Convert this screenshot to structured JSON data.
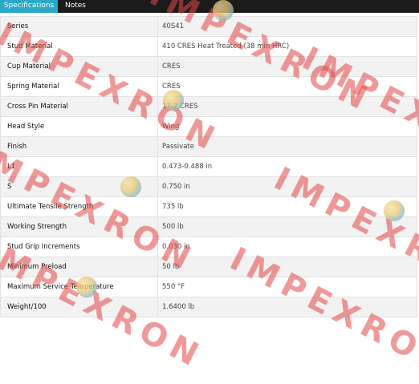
{
  "tabs": [
    {
      "label": "Specifications",
      "active": true
    },
    {
      "label": "Notes",
      "active": false
    }
  ],
  "specs": [
    {
      "label": "Series",
      "value": "40S41"
    },
    {
      "label": "Stud Material",
      "value": "410 CRES Heat Treated (38 min HRC)"
    },
    {
      "label": "Cup Material",
      "value": "CRES"
    },
    {
      "label": "Spring Material",
      "value": "CRES"
    },
    {
      "label": "Cross Pin Material",
      "value": "17-7 CRES"
    },
    {
      "label": "Head Style",
      "value": "Wing"
    },
    {
      "label": "Finish",
      "value": "Passivate"
    },
    {
      "label": "L1",
      "value": "0.473-0.488 in"
    },
    {
      "label": "S",
      "value": "0.750 in"
    },
    {
      "label": "Ultimate Tensile Strength",
      "value": "735 lb"
    },
    {
      "label": "Working Strength",
      "value": "500 lb"
    },
    {
      "label": "Stud Grip Increments",
      "value": "0.030 in"
    },
    {
      "label": "Minimum Preload",
      "value": "50 lb"
    },
    {
      "label": "Maximum Service Temperature",
      "value": "550 °F"
    },
    {
      "label": "Weight/100",
      "value": "1.6400 lb"
    }
  ],
  "watermark": {
    "text": "IMPEXRON",
    "color": "#e44646"
  }
}
